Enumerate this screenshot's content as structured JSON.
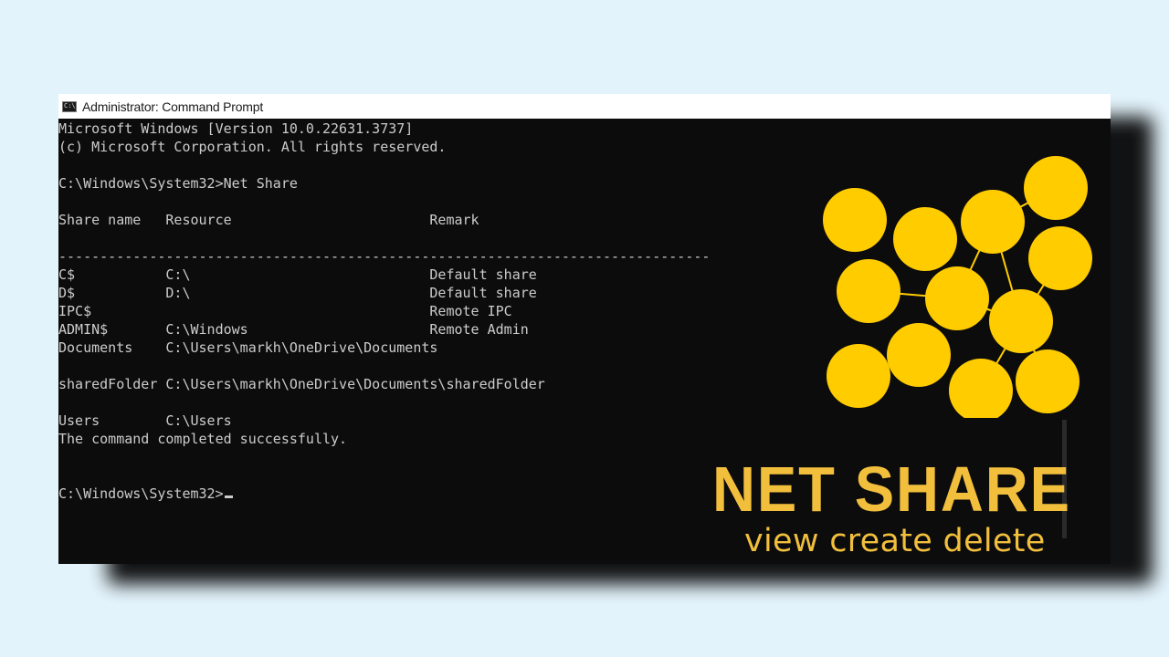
{
  "window": {
    "title": "Administrator: Command Prompt",
    "app_icon_text": "C:\\"
  },
  "console": {
    "lines": [
      "Microsoft Windows [Version 10.0.22631.3737]",
      "(c) Microsoft Corporation. All rights reserved.",
      "",
      "C:\\Windows\\System32>Net Share",
      "",
      "Share name   Resource                        Remark",
      "",
      "-------------------------------------------------------------------------------",
      "C$           C:\\                             Default share",
      "D$           D:\\                             Default share",
      "IPC$                                         Remote IPC",
      "ADMIN$       C:\\Windows                      Remote Admin",
      "Documents    C:\\Users\\markh\\OneDrive\\Documents",
      "",
      "sharedFolder C:\\Users\\markh\\OneDrive\\Documents\\sharedFolder",
      "",
      "Users        C:\\Users",
      "The command completed successfully.",
      "",
      "",
      "C:\\Windows\\System32>"
    ]
  },
  "brand": {
    "title": "NET SHARE",
    "subtitle": "view create delete",
    "accent_color": "#f2bf3d",
    "node_color": "#ffcc00"
  }
}
